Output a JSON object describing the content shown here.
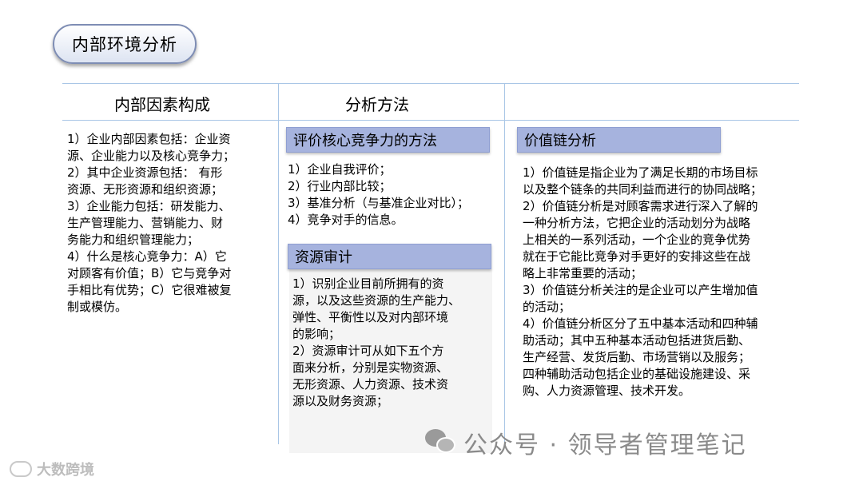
{
  "title": "内部环境分析",
  "columns": {
    "left_header": "内部因素构成",
    "middle_header": "分析方法"
  },
  "left_text": [
    "1）企业内部因素包括：企业资",
    "源、企业能力以及核心竞争力；",
    "2）其中企业资源包括： 有形",
    "资源、无形资源和组织资源；",
    "3）企业能力包括：研发能力、",
    "生产管理能力、营销能力、财",
    "务能力和组织管理能力；",
    "4）什么是核心竞争力：A）它",
    "对顾客有价值；B）它与竞争对",
    "手相比有优势；C）它很难被复",
    "制或模仿。"
  ],
  "core_method": {
    "heading": "评价核心竞争力的方法",
    "lines": [
      "1）企业自我评价；",
      "2）行业内部比较；",
      "3）基准分析（与基准企业对比）；",
      "4）竞争对手的信息。"
    ]
  },
  "resource_audit": {
    "heading": "资源审计",
    "lines": [
      "1）识别企业目前所拥有的资",
      "源，以及这些资源的生产能力、",
      "弹性、平衡性以及对内部环境",
      "的影响；",
      "2）资源审计可从如下五个方",
      "面来分析，分别是实物资源、",
      "无形资源、人力资源、技术资",
      "源以及财务资源；"
    ]
  },
  "value_chain": {
    "heading": "价值链分析",
    "lines": [
      "1）价值链是指企业为了满足长期的市场目标",
      "以及整个链条的共同利益而进行的协同战略；",
      "2）价值链分析是对顾客需求进行深入了解的",
      "一种分析方法，它把企业的活动划分为战略",
      "上相关的一系列活动，一个企业的竞争优势",
      "就在于它能比竞争对手更好的安排这些在战",
      "略上非常重要的活动；",
      "3）价值链分析关注的是企业可以产生增加值",
      "的活动；",
      "4）价值链分析区分了五中基本活动和四种辅",
      "助活动；其中五种基本活动包括进货后勤、",
      "生产经营、发货后勤、市场营销以及服务；",
      "四种辅助活动包括企业的基础设施建设、采",
      "购、人力资源管理、技术开发。"
    ]
  },
  "watermark": {
    "wechat": "公众号 · 领导者管理笔记",
    "logo": "大数跨境"
  },
  "colors": {
    "subhead_fill": "#a6b3de",
    "rule_line": "#a9c6e6"
  }
}
